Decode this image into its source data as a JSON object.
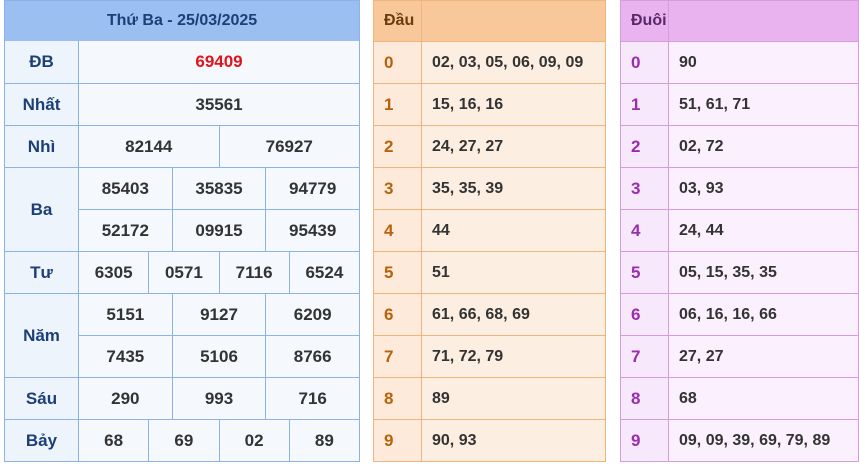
{
  "header": {
    "title": "Thứ Ba - 25/03/2025"
  },
  "prizes": [
    {
      "label": "ĐB",
      "lines": [
        [
          "69409"
        ]
      ],
      "highlight": true
    },
    {
      "label": "Nhất",
      "lines": [
        [
          "35561"
        ]
      ]
    },
    {
      "label": "Nhì",
      "lines": [
        [
          "82144",
          "76927"
        ]
      ]
    },
    {
      "label": "Ba",
      "lines": [
        [
          "85403",
          "35835",
          "94779"
        ],
        [
          "52172",
          "09915",
          "95439"
        ]
      ]
    },
    {
      "label": "Tư",
      "lines": [
        [
          "6305",
          "0571",
          "7116",
          "6524"
        ]
      ]
    },
    {
      "label": "Năm",
      "lines": [
        [
          "5151",
          "9127",
          "6209"
        ],
        [
          "7435",
          "5106",
          "8766"
        ]
      ]
    },
    {
      "label": "Sáu",
      "lines": [
        [
          "290",
          "993",
          "716"
        ]
      ]
    },
    {
      "label": "Bảy",
      "lines": [
        [
          "68",
          "69",
          "02",
          "89"
        ]
      ]
    }
  ],
  "head_table": {
    "title": "Đầu",
    "rows": [
      {
        "key": "0",
        "value": "02, 03, 05, 06, 09, 09"
      },
      {
        "key": "1",
        "value": "15, 16, 16"
      },
      {
        "key": "2",
        "value": "24, 27, 27"
      },
      {
        "key": "3",
        "value": "35, 35, 39"
      },
      {
        "key": "4",
        "value": "44"
      },
      {
        "key": "5",
        "value": "51"
      },
      {
        "key": "6",
        "value": "61, 66, 68, 69"
      },
      {
        "key": "7",
        "value": "71, 72, 79"
      },
      {
        "key": "8",
        "value": "89"
      },
      {
        "key": "9",
        "value": "90, 93"
      }
    ]
  },
  "tail_table": {
    "title": "Đuôi",
    "rows": [
      {
        "key": "0",
        "value": "90"
      },
      {
        "key": "1",
        "value": "51, 61, 71"
      },
      {
        "key": "2",
        "value": "02, 72"
      },
      {
        "key": "3",
        "value": "03, 93"
      },
      {
        "key": "4",
        "value": "24, 44"
      },
      {
        "key": "5",
        "value": "05, 15, 35, 35"
      },
      {
        "key": "6",
        "value": "06, 16, 16, 66"
      },
      {
        "key": "7",
        "value": "27, 27"
      },
      {
        "key": "8",
        "value": "68"
      },
      {
        "key": "9",
        "value": "09, 09, 39, 69, 79, 89"
      }
    ]
  },
  "colors": {
    "special_prize": "#e0151b",
    "results_header": "#9bbff0",
    "head_header": "#f9c89a",
    "tail_header": "#e8b3ef"
  }
}
